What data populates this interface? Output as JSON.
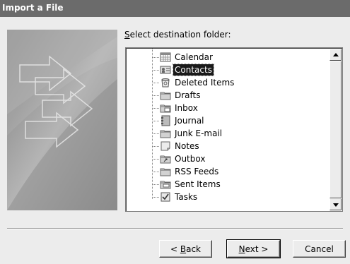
{
  "window": {
    "title": "Import a File"
  },
  "destination_label": {
    "prefix": "",
    "accel": "S",
    "rest": "elect destination folder:"
  },
  "folders": [
    {
      "label": "Calendar",
      "icon": "calendar-icon",
      "selected": false
    },
    {
      "label": "Contacts",
      "icon": "contacts-icon",
      "selected": true
    },
    {
      "label": "Deleted Items",
      "icon": "deleted-items-icon",
      "selected": false
    },
    {
      "label": "Drafts",
      "icon": "folder-icon",
      "selected": false
    },
    {
      "label": "Inbox",
      "icon": "inbox-icon",
      "selected": false
    },
    {
      "label": "Journal",
      "icon": "journal-icon",
      "selected": false
    },
    {
      "label": "Junk E-mail",
      "icon": "folder-icon",
      "selected": false
    },
    {
      "label": "Notes",
      "icon": "notes-icon",
      "selected": false
    },
    {
      "label": "Outbox",
      "icon": "outbox-icon",
      "selected": false
    },
    {
      "label": "RSS Feeds",
      "icon": "folder-icon",
      "selected": false
    },
    {
      "label": "Sent Items",
      "icon": "sent-items-icon",
      "selected": false
    },
    {
      "label": "Tasks",
      "icon": "tasks-icon",
      "selected": false
    }
  ],
  "buttons": {
    "back": {
      "prefix": "< ",
      "accel": "B",
      "rest": "ack"
    },
    "next": {
      "prefix": "",
      "accel": "N",
      "rest": "ext >"
    },
    "cancel": {
      "label": "Cancel"
    }
  }
}
